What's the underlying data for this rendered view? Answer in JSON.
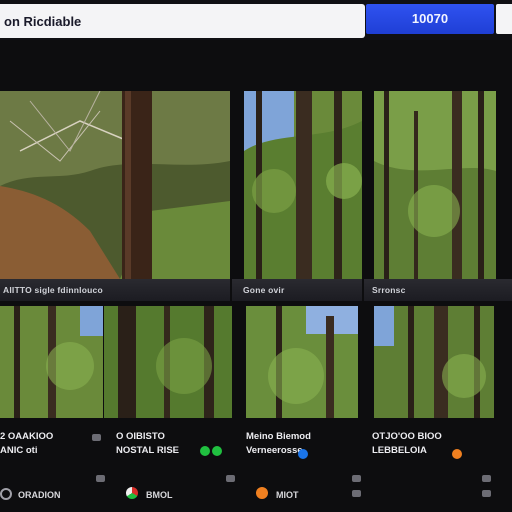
{
  "header": {
    "search_value": "on Ricdiable",
    "action_button": "10070"
  },
  "photos": [
    {
      "caption": "AIITTO sigle fdinnlouco",
      "scene": "slope"
    },
    {
      "caption": "Gone ovir",
      "scene": "tall-forest"
    },
    {
      "caption": "Srronsc",
      "scene": "tall-forest-2"
    },
    {
      "caption": "",
      "scene": "woodland"
    },
    {
      "caption": "",
      "scene": "dense-forest"
    },
    {
      "caption": "",
      "scene": "sky-forest"
    },
    {
      "caption": "",
      "scene": "right-forest"
    }
  ],
  "cards": [
    {
      "title": "2 OAAKIOO",
      "subtitle": "ANIC oti"
    },
    {
      "title": "O OIBISTO",
      "subtitle": "NOSTAL RISE"
    },
    {
      "title": "Meino Biemod",
      "subtitle": "Verneerosse"
    },
    {
      "title": "OTJO'OO BIOO",
      "subtitle": "LEBBELOIA"
    }
  ],
  "footer": [
    {
      "label": "ORADION",
      "icon": "circle-outline-icon"
    },
    {
      "label": "BMOL",
      "icon": "tricolor-badge-icon"
    },
    {
      "label": "MIOT",
      "icon": "orange-dot-icon"
    }
  ],
  "colors": {
    "accent": "#2444e6",
    "green": "#20c040",
    "blue": "#1a74e8",
    "orange": "#f08020",
    "red": "#d8302a"
  }
}
